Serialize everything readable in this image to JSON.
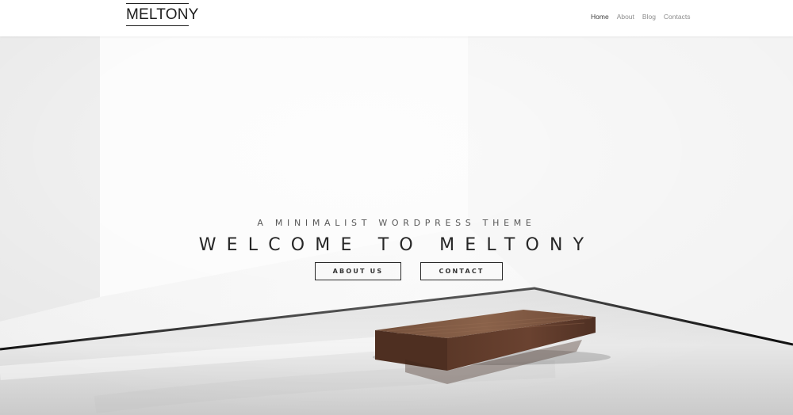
{
  "site": {
    "logo": "MELTONY"
  },
  "navigation": {
    "items": [
      {
        "label": "Home",
        "active": true
      },
      {
        "label": "About",
        "active": false
      },
      {
        "label": "Blog",
        "active": false
      },
      {
        "label": "Contacts",
        "active": false
      }
    ]
  },
  "hero": {
    "subtitle": "A MINIMALIST WORDPRESS THEME",
    "title": "WELCOME TO MELTONY",
    "buttons": [
      {
        "label": "ABOUT US"
      },
      {
        "label": "CONTACT"
      }
    ]
  },
  "colors": {
    "text_primary": "#272727",
    "nav_active": "#3d3d3d",
    "nav_inactive": "#8d8d8d",
    "bench_wood": "#6b4432"
  }
}
